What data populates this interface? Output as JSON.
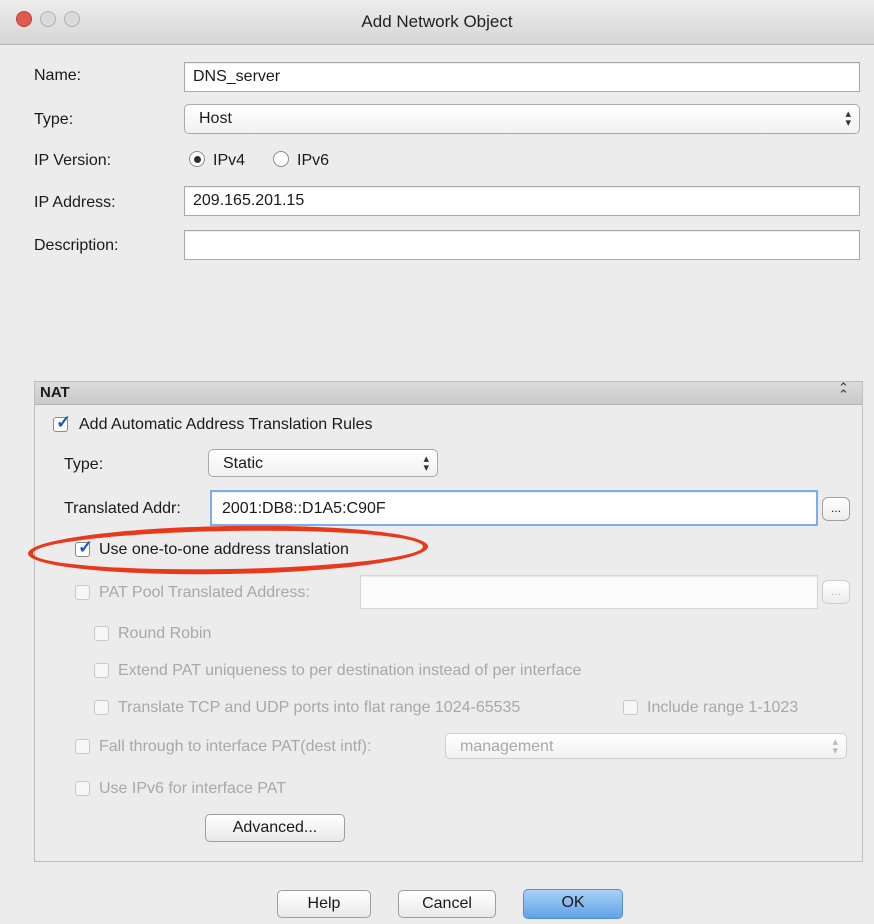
{
  "window": {
    "title": "Add Network Object"
  },
  "form": {
    "name_label": "Name:",
    "name_value": "DNS_server",
    "type_label": "Type:",
    "type_value": "Host",
    "ip_version_label": "IP Version:",
    "ipv4_label": "IPv4",
    "ipv6_label": "IPv6",
    "ip_version_selected": "IPv4",
    "ip_address_label": "IP Address:",
    "ip_address_value": "209.165.201.15",
    "description_label": "Description:",
    "description_value": ""
  },
  "nat": {
    "header": "NAT",
    "collapse_icon": "⌃",
    "auto_rules_label": "Add Automatic Address Translation Rules",
    "auto_rules_checked": true,
    "type_label": "Type:",
    "type_value": "Static",
    "translated_addr_label": "Translated Addr:",
    "translated_addr_value": "2001:DB8::D1A5:C90F",
    "browse_label": "...",
    "one_to_one_label": "Use one-to-one address translation",
    "one_to_one_checked": true,
    "pat_pool_label": "PAT Pool Translated Address:",
    "pat_pool_value": "",
    "round_robin_label": "Round Robin",
    "extend_pat_label": "Extend PAT uniqueness to per destination instead of per interface",
    "translate_ports_label": "Translate TCP and UDP ports into flat range 1024-65535",
    "include_range_label": "Include range 1-1023",
    "fall_through_label": "Fall through to interface PAT(dest intf):",
    "fall_through_value": "management",
    "use_ipv6_label": "Use IPv6 for interface PAT",
    "advanced_label": "Advanced..."
  },
  "buttons": {
    "help": "Help",
    "cancel": "Cancel",
    "ok": "OK"
  },
  "colors": {
    "highlight": "#e8391c",
    "ok_button": "#5fa3e6",
    "check": "#1f57b9"
  }
}
